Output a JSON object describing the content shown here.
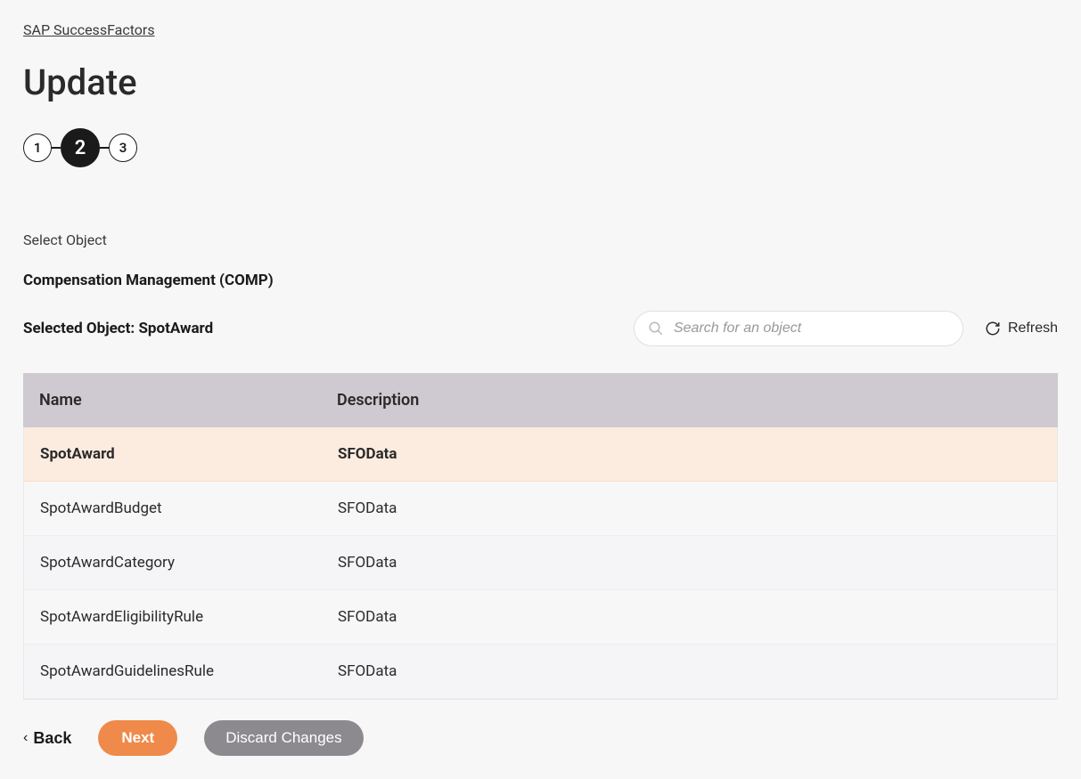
{
  "breadcrumb": {
    "product": "SAP SuccessFactors"
  },
  "page": {
    "title": "Update"
  },
  "stepper": {
    "steps": [
      "1",
      "2",
      "3"
    ],
    "active_index": 1
  },
  "section": {
    "select_object_label": "Select Object",
    "category": "Compensation Management (COMP)",
    "selected_prefix": "Selected Object: ",
    "selected_name": "SpotAward"
  },
  "search": {
    "placeholder": "Search for an object"
  },
  "refresh": {
    "label": "Refresh"
  },
  "table": {
    "headers": {
      "name": "Name",
      "description": "Description"
    },
    "rows": [
      {
        "name": "SpotAward",
        "description": "SFOData",
        "selected": true
      },
      {
        "name": "SpotAwardBudget",
        "description": "SFOData"
      },
      {
        "name": "SpotAwardCategory",
        "description": "SFOData",
        "alt": true
      },
      {
        "name": "SpotAwardEligibilityRule",
        "description": "SFOData"
      },
      {
        "name": "SpotAwardGuidelinesRule",
        "description": "SFOData",
        "alt": true
      }
    ]
  },
  "footer": {
    "back": "Back",
    "next": "Next",
    "discard": "Discard Changes"
  }
}
